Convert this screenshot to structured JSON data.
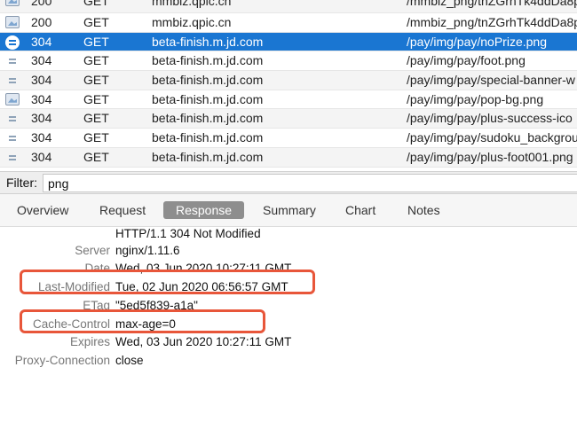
{
  "requests": [
    {
      "status": "200",
      "method": "GET",
      "host": "mmbiz.qpic.cn",
      "path": "/mmbiz_png/tnZGrhTk4ddDa8p",
      "icon": "image-icon"
    },
    {
      "status": "200",
      "method": "GET",
      "host": "mmbiz.qpic.cn",
      "path": "/mmbiz_png/tnZGrhTk4ddDa8p",
      "icon": "image-icon"
    },
    {
      "status": "304",
      "method": "GET",
      "host": "beta-finish.m.jd.com",
      "path": "/pay/img/pay/noPrize.png",
      "icon": "document-lines-icon"
    },
    {
      "status": "304",
      "method": "GET",
      "host": "beta-finish.m.jd.com",
      "path": "/pay/img/pay/foot.png",
      "icon": "document-lines-icon"
    },
    {
      "status": "304",
      "method": "GET",
      "host": "beta-finish.m.jd.com",
      "path": "/pay/img/pay/special-banner-w",
      "icon": "document-lines-icon"
    },
    {
      "status": "304",
      "method": "GET",
      "host": "beta-finish.m.jd.com",
      "path": "/pay/img/pay/pop-bg.png",
      "icon": "image-icon"
    },
    {
      "status": "304",
      "method": "GET",
      "host": "beta-finish.m.jd.com",
      "path": "/pay/img/pay/plus-success-ico",
      "icon": "document-lines-icon"
    },
    {
      "status": "304",
      "method": "GET",
      "host": "beta-finish.m.jd.com",
      "path": "/pay/img/pay/sudoku_backgrou",
      "icon": "document-lines-icon"
    },
    {
      "status": "304",
      "method": "GET",
      "host": "beta-finish.m.jd.com",
      "path": "/pay/img/pay/plus-foot001.png",
      "icon": "document-lines-icon"
    }
  ],
  "selected_index": 2,
  "filter": {
    "label": "Filter:",
    "value": "png"
  },
  "tabs": [
    {
      "label": "Overview",
      "active": false
    },
    {
      "label": "Request",
      "active": false
    },
    {
      "label": "Response",
      "active": true
    },
    {
      "label": "Summary",
      "active": false
    },
    {
      "label": "Chart",
      "active": false
    },
    {
      "label": "Notes",
      "active": false
    }
  ],
  "response": {
    "status_line": "HTTP/1.1 304 Not Modified",
    "headers": [
      {
        "key": "Server",
        "value": "nginx/1.11.6"
      },
      {
        "key": "Date",
        "value": "Wed, 03 Jun 2020 10:27:11 GMT"
      },
      {
        "key": "Last-Modified",
        "value": "Tue, 02 Jun 2020 06:56:57 GMT"
      },
      {
        "key": "ETag",
        "value": "\"5ed5f839-a1a\""
      },
      {
        "key": "Cache-Control",
        "value": "max-age=0"
      },
      {
        "key": "Expires",
        "value": "Wed, 03 Jun 2020 10:27:11 GMT"
      },
      {
        "key": "Proxy-Connection",
        "value": "close"
      }
    ]
  },
  "colors": {
    "selection": "#1a76d2",
    "annotation": "#e8563a",
    "active_tab": "#8e8e8e"
  }
}
